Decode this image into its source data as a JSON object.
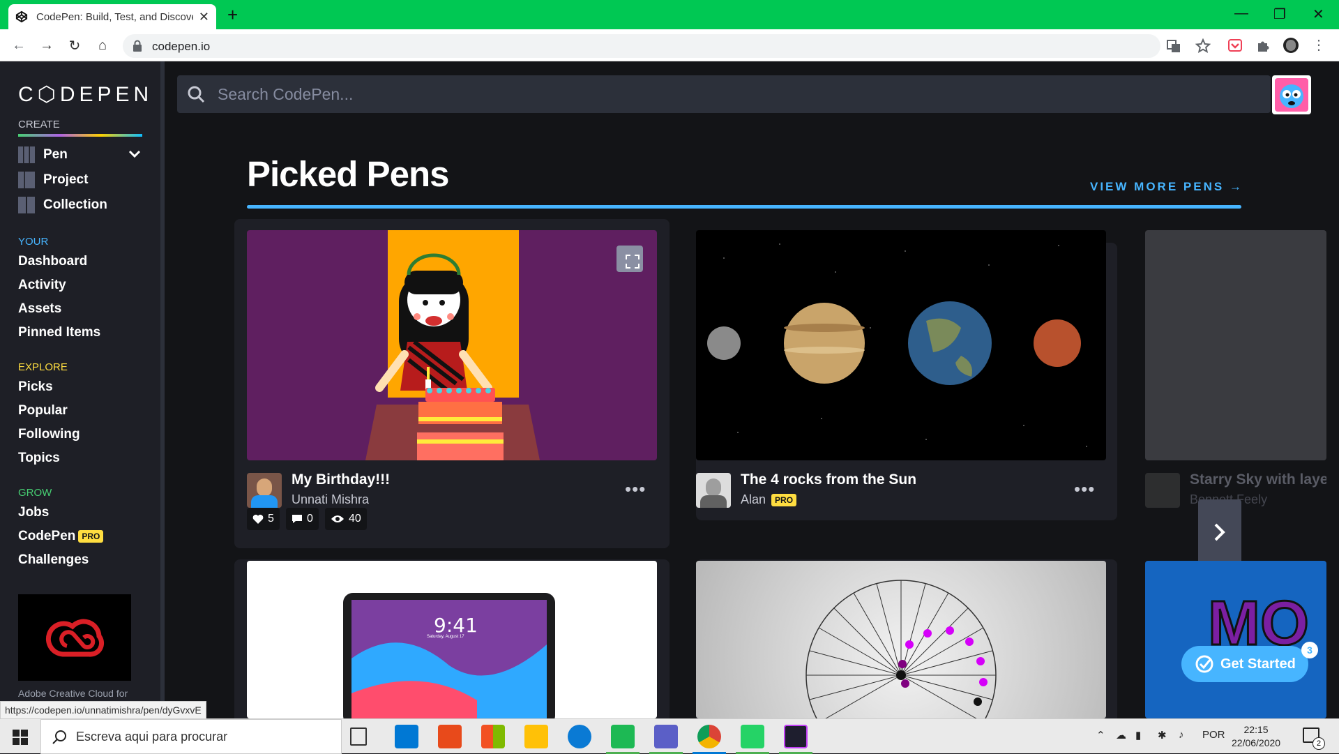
{
  "browser": {
    "tab_title": "CodePen: Build, Test, and Discover Front-end Code.",
    "new_tab": "+",
    "close_tab": "✕",
    "url": "codepen.io",
    "window_controls": [
      "minimize",
      "maximize",
      "close"
    ]
  },
  "sidebar": {
    "logo": "C⬡DEPEN",
    "create_label": "CREATE",
    "create_items": [
      {
        "label": "Pen",
        "icon": "pen-grid-icon"
      },
      {
        "label": "Project",
        "icon": "project-icon"
      },
      {
        "label": "Collection",
        "icon": "collection-icon"
      }
    ],
    "your_label": "YOUR",
    "your_items": [
      "Dashboard",
      "Activity",
      "Assets",
      "Pinned Items"
    ],
    "explore_label": "EXPLORE",
    "explore_items": [
      "Picks",
      "Popular",
      "Following",
      "Topics"
    ],
    "grow_label": "GROW",
    "grow_items": [
      "Jobs",
      "CodePen",
      "Challenges"
    ],
    "pro_badge": "PRO",
    "ad_caption": "Adobe Creative Cloud for"
  },
  "main": {
    "search_placeholder": "Search CodePen...",
    "heading": "Picked Pens",
    "view_more": "VIEW MORE PENS",
    "cards": [
      {
        "title": "My Birthday!!!",
        "author": "Unnati Mishra",
        "likes": "5",
        "comments": "0",
        "views": "40",
        "pro": false
      },
      {
        "title": "The 4 rocks from the Sun",
        "author": "Alan",
        "pro": true
      },
      {
        "title": "Starry Sky with laye",
        "author": "Bennett Feely",
        "pro": false
      }
    ],
    "more": "•••",
    "get_started": "Get Started",
    "get_started_count": "3",
    "ipad_time": "9:41",
    "ipad_date": "Saturday, August 17"
  },
  "status_url": "https://codepen.io/unnatimishra/pen/dyGvxvE",
  "taskbar": {
    "search_placeholder": "Escreva aqui para procurar",
    "language": "POR",
    "time": "22:15",
    "date": "22/06/2020",
    "notification_count": "2"
  },
  "colors": {
    "accent_blue": "#47b5ff",
    "pro_yellow": "#ffdd40",
    "chrome_green": "#00c853"
  }
}
